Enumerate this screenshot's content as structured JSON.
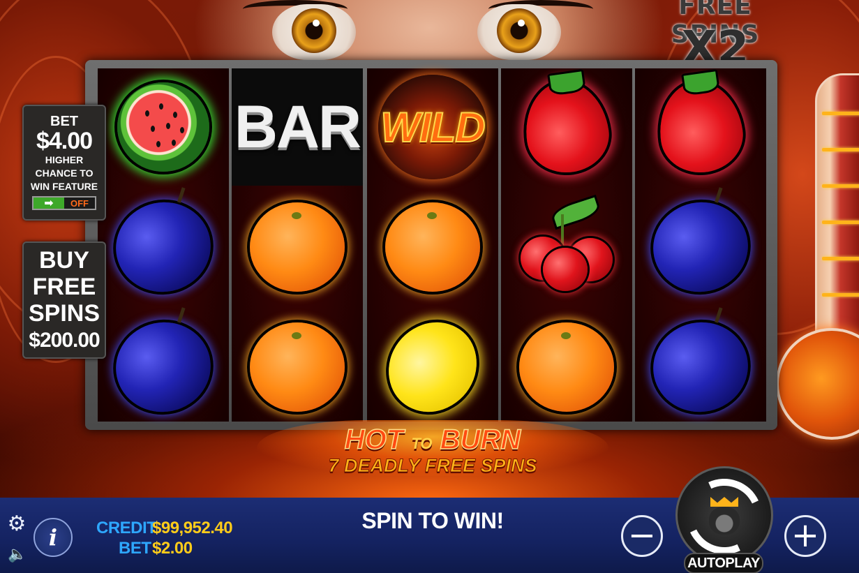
{
  "game": {
    "free_spins_title": "FREE SPINS",
    "free_spins_multiplier": "X2",
    "logo_line1_a": "HOT",
    "logo_line1_to": "TO",
    "logo_line1_b": "BURN",
    "logo_line2": "7 DEADLY FREE SPINS"
  },
  "bet_feature": {
    "label": "BET",
    "amount": "$4.00",
    "line1": "HIGHER",
    "line2": "CHANCE TO",
    "line3": "WIN FEATURE",
    "toggle_on_icon": "➡",
    "toggle_state": "OFF"
  },
  "buy_free_spins": {
    "line1": "BUY",
    "line2": "FREE",
    "line3": "SPINS",
    "price": "$200.00"
  },
  "reels": [
    [
      "watermelon",
      "plum",
      "plum"
    ],
    [
      "bar",
      "orange",
      "orange"
    ],
    [
      "wild",
      "orange",
      "lemon"
    ],
    [
      "strawberry",
      "cherry",
      "orange"
    ],
    [
      "strawberry",
      "plum",
      "plum"
    ]
  ],
  "symbols": {
    "bar_text": "BAR",
    "wild_text": "WILD"
  },
  "bottom_bar": {
    "credit_label": "CREDIT",
    "credit_value": "$99,952.40",
    "bet_label": "BET",
    "bet_value": "$2.00",
    "message": "SPIN TO WIN!",
    "minus": "−",
    "plus": "+",
    "autoplay_label": "AUTOPLAY",
    "settings_icon": "⚙",
    "sound_icon": "🔈",
    "info_icon": "i"
  },
  "colors": {
    "credit_label": "#2ea7ff",
    "credit_value": "#ffcc1a",
    "bar_bg": "#1c2d74"
  }
}
